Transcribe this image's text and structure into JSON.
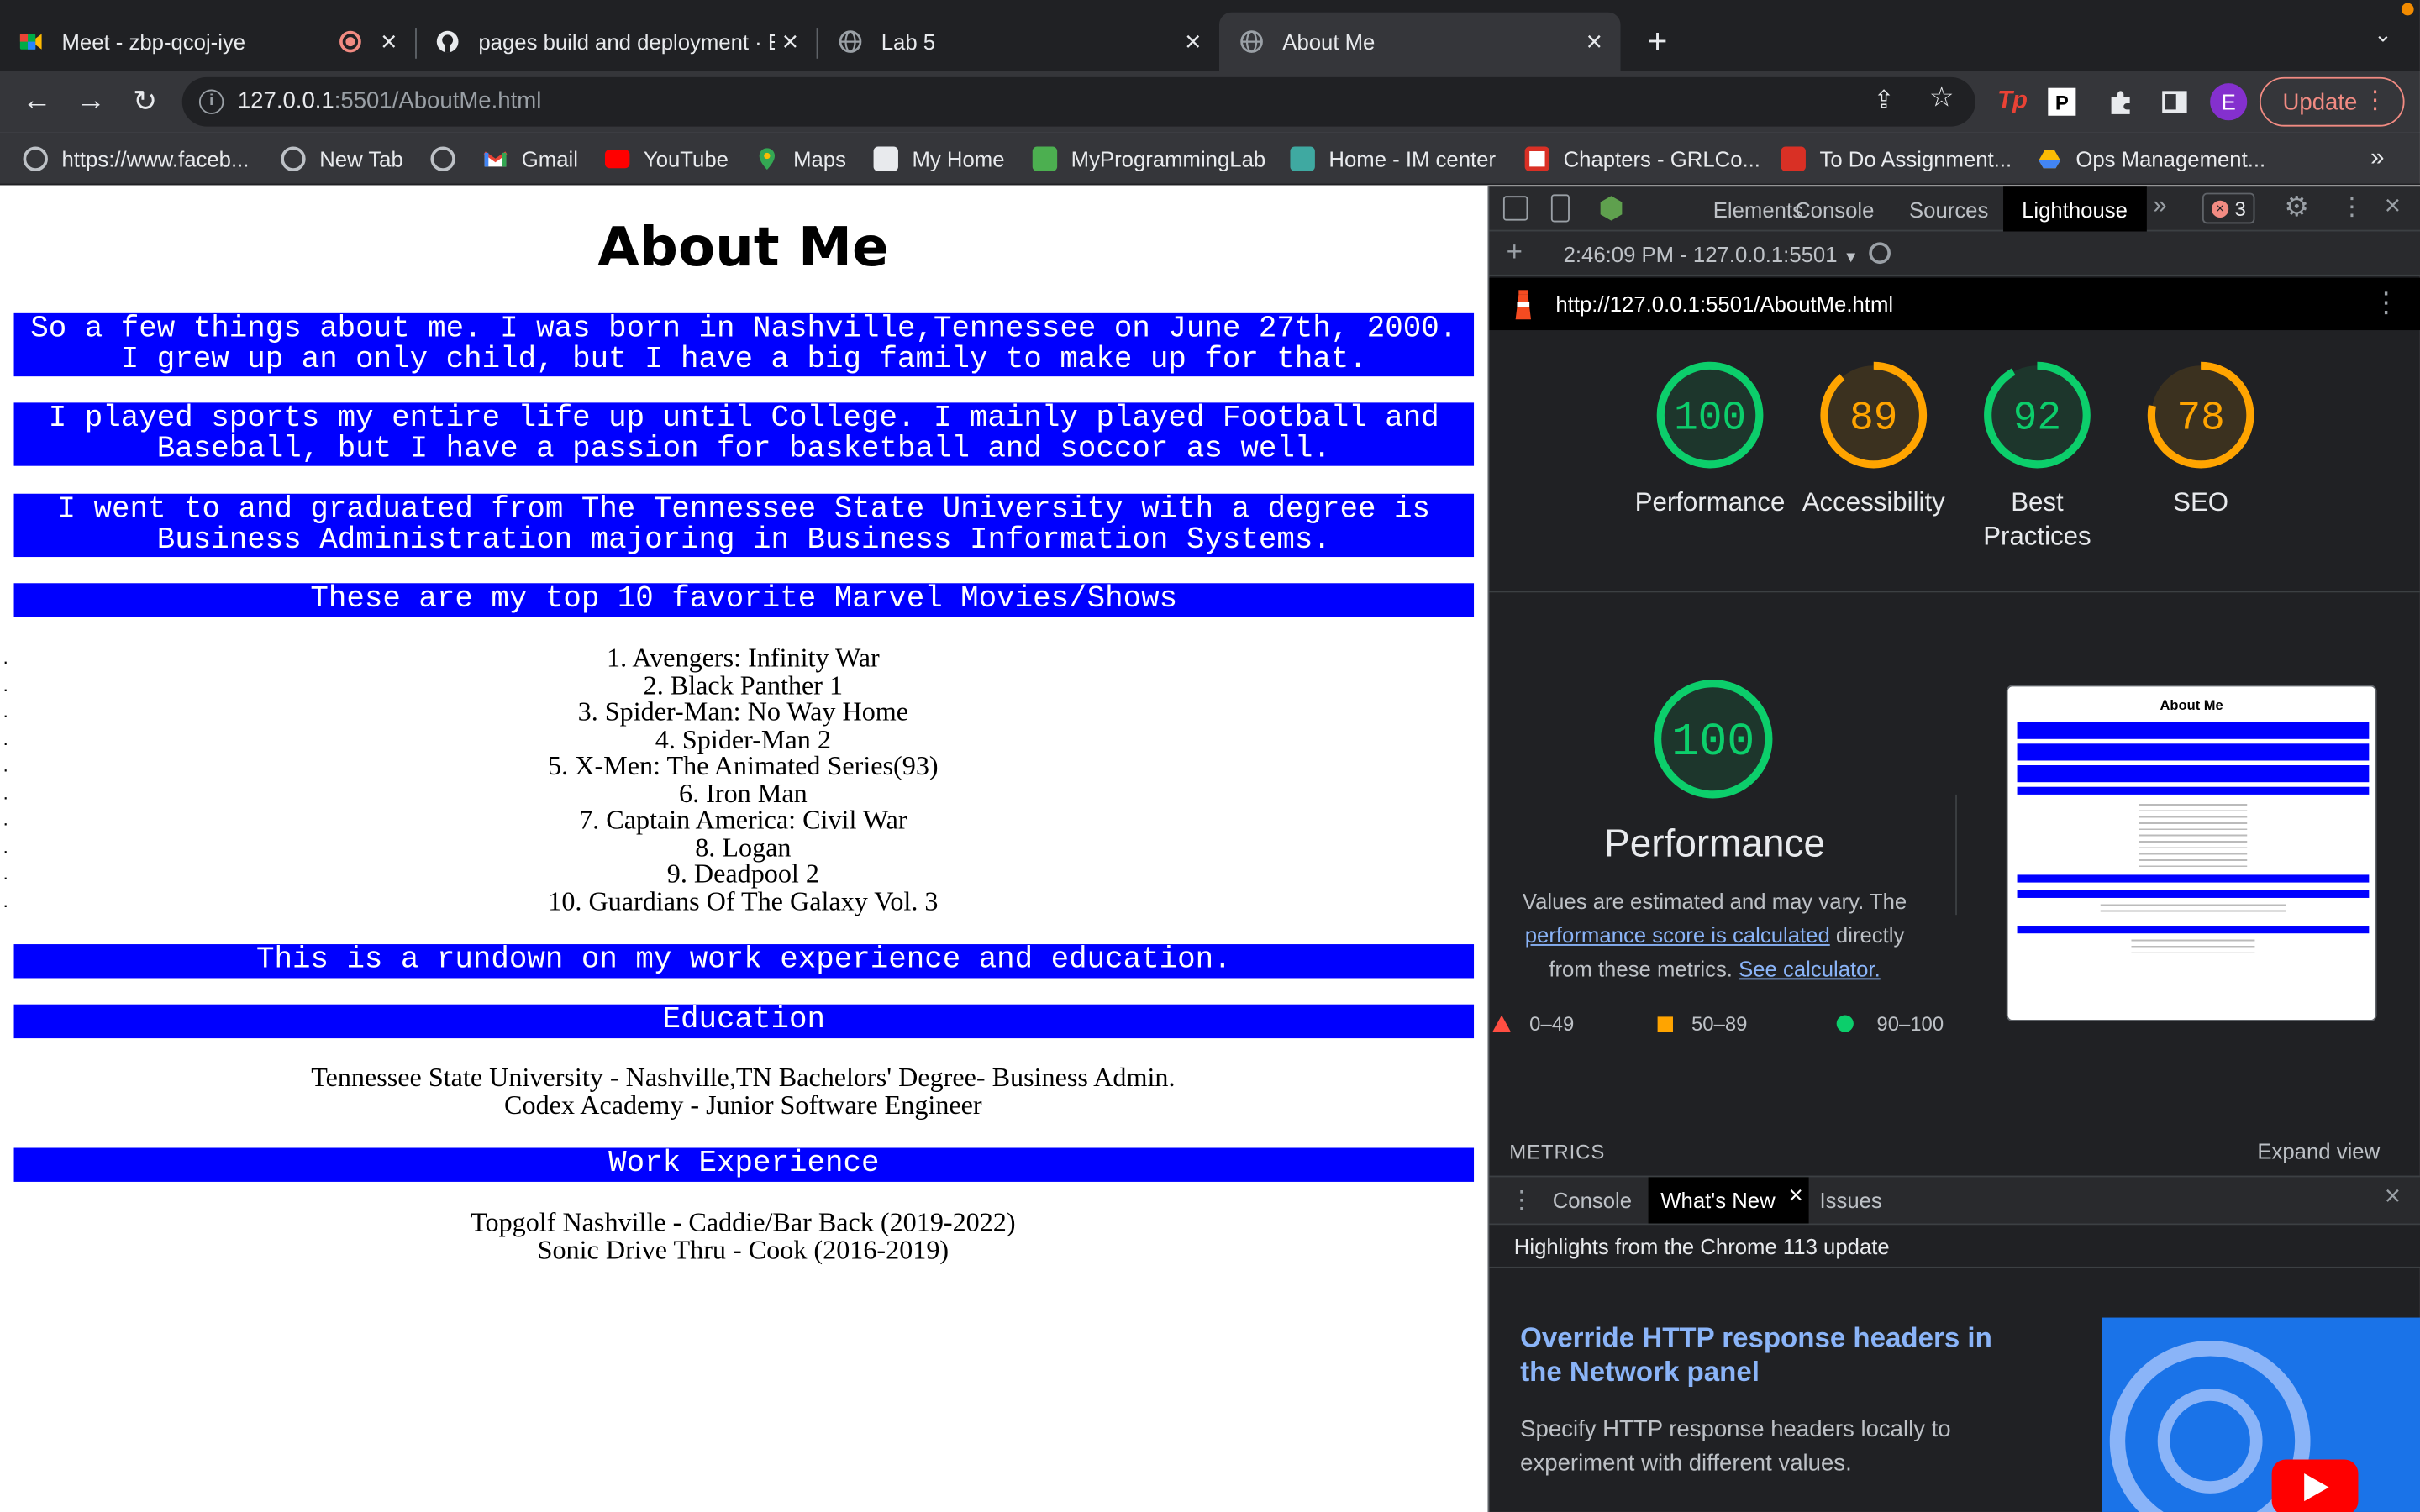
{
  "browser": {
    "tabs": [
      {
        "title": "Meet - zbp-qcoj-iye",
        "icon": "google-meet-icon"
      },
      {
        "title": "pages build and deployment · E",
        "icon": "github-icon"
      },
      {
        "title": "Lab 5",
        "icon": "globe-icon"
      },
      {
        "title": "About Me",
        "icon": "globe-icon"
      }
    ],
    "url_host": "127.0.0.1",
    "url_rest": ":5501/AboutMe.html",
    "update_label": "Update",
    "profile_initial": "E",
    "bookmarks": [
      {
        "label": "https://www.faceb...",
        "icon": "globe-icon"
      },
      {
        "label": "New Tab",
        "icon": "globe-icon"
      },
      {
        "label": "",
        "icon": "globe-icon"
      },
      {
        "label": "Gmail",
        "icon": "gmail-icon"
      },
      {
        "label": "YouTube",
        "icon": "youtube-icon"
      },
      {
        "label": "Maps",
        "icon": "maps-icon"
      },
      {
        "label": "My Home",
        "icon": "myhome-icon"
      },
      {
        "label": "MyProgrammingLab",
        "icon": "mpl-icon"
      },
      {
        "label": "Home - IM center",
        "icon": "im-center-icon"
      },
      {
        "label": "Chapters - GRLCo...",
        "icon": "chapters-icon"
      },
      {
        "label": "To Do Assignment...",
        "icon": "mcgraw-icon"
      },
      {
        "label": "Ops Management...",
        "icon": "drive-icon"
      }
    ],
    "more_bookmarks": "»"
  },
  "page": {
    "title": "About Me",
    "para1": [
      "So a few things about me. I was born in Nashville,Tennessee on June 27th, 2000.",
      "I grew up an only child, but I have a big family to make up for that."
    ],
    "para2": [
      "I played sports my entire life up until College. I mainly played Football and",
      "Baseball, but I have a passion for basketball and soccor as well."
    ],
    "para3": [
      "I went to and graduated from The Tennessee State University with a degree is",
      "Business Administration majoring in Business Information Systems."
    ],
    "movies_heading": "These are my top 10 favorite Marvel Movies/Shows",
    "movies": [
      "1. Avengers: Infinity War",
      "2. Black Panther 1",
      "3. Spider-Man: No Way Home",
      "4. Spider-Man 2",
      "5. X-Men: The Animated Series(93)",
      "6. Iron Man",
      "7. Captain America: Civil War",
      "8. Logan",
      "9. Deadpool 2",
      "10. Guardians Of The Galaxy Vol. 3"
    ],
    "rundown": "This is a rundown on my work experience and education.",
    "education_heading": "Education",
    "education": [
      "Tennessee State University - Nashville,TN Bachelors' Degree- Business Admin.",
      "Codex Academy - Junior Software Engineer"
    ],
    "work_heading": "Work Experience",
    "work": [
      "Topgolf Nashville - Caddie/Bar Back (2019-2022)",
      "Sonic Drive Thru - Cook (2016-2019)"
    ]
  },
  "devtools": {
    "tabs": [
      "Elements",
      "Console",
      "Sources",
      "Lighthouse"
    ],
    "error_count": "3",
    "report_select": "2:46:09 PM - 127.0.0.1:5501",
    "report_url": "http://127.0.0.1:5501/AboutMe.html",
    "scores": [
      {
        "label": "Performance",
        "value": 100,
        "color": "#0cce6b"
      },
      {
        "label": "Accessibility",
        "value": 89,
        "color": "#ffa400"
      },
      {
        "label": "Best Practices",
        "value": 92,
        "color": "#0cce6b"
      },
      {
        "label": "SEO",
        "value": 78,
        "color": "#ffa400"
      }
    ],
    "perf_score": 100,
    "perf_title": "Performance",
    "perf_desc_1": "Values are estimated and may vary. The",
    "perf_link": "performance score is calculated",
    "perf_desc_2": "directly from these metrics.",
    "calc_link": "See calculator.",
    "legend": [
      "0–49",
      "50–89",
      "90–100"
    ],
    "thumb_title": "About Me",
    "metrics_label": "METRICS",
    "expand_view": "Expand view",
    "drawer_tabs": [
      "Console",
      "What's New",
      "Issues"
    ],
    "whatsnew_header": "Highlights from the Chrome 113 update",
    "whatsnew_title": "Override HTTP response headers in the Network panel",
    "whatsnew_desc": "Specify HTTP response headers locally to experiment with different values."
  }
}
